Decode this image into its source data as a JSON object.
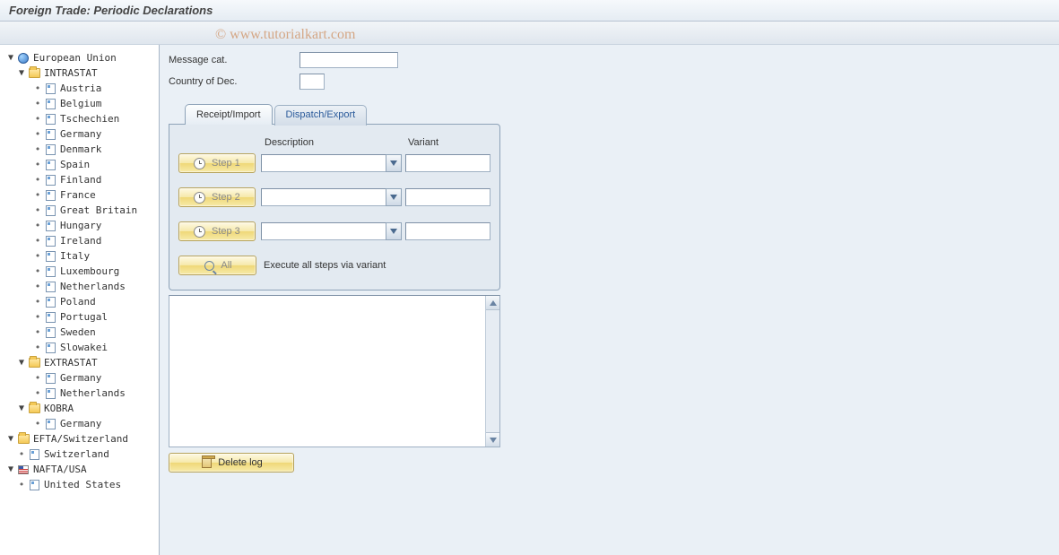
{
  "title": "Foreign Trade: Periodic Declarations",
  "watermark": "© www.tutorialkart.com",
  "tree": {
    "root": {
      "label": "European Union"
    },
    "intrastat": {
      "label": "INTRASTAT"
    },
    "intrastat_items": [
      "Austria",
      "Belgium",
      "Tschechien",
      "Germany",
      "Denmark",
      "Spain",
      "Finland",
      "France",
      "Great Britain",
      "Hungary",
      "Ireland",
      "Italy",
      "Luxembourg",
      "Netherlands",
      "Poland",
      "Portugal",
      "Sweden",
      "Slowakei"
    ],
    "extrastat": {
      "label": "EXTRASTAT"
    },
    "extrastat_items": [
      "Germany",
      "Netherlands"
    ],
    "kobra": {
      "label": "KOBRA"
    },
    "kobra_items": [
      "Germany"
    ],
    "efta": {
      "label": "EFTA/Switzerland"
    },
    "efta_items": [
      "Switzerland"
    ],
    "nafta": {
      "label": "NAFTA/USA"
    },
    "nafta_items": [
      "United States"
    ]
  },
  "fields": {
    "message_cat": {
      "label": "Message cat.",
      "value": ""
    },
    "country": {
      "label": "Country of Dec.",
      "value": ""
    }
  },
  "tabs": {
    "receipt": "Receipt/Import",
    "dispatch": "Dispatch/Export"
  },
  "columns": {
    "desc": "Description",
    "variant": "Variant"
  },
  "steps": {
    "s1": "Step 1",
    "s2": "Step 2",
    "s3": "Step 3",
    "all": "All",
    "all_text": "Execute all steps via variant"
  },
  "buttons": {
    "delete_log": "Delete log"
  }
}
